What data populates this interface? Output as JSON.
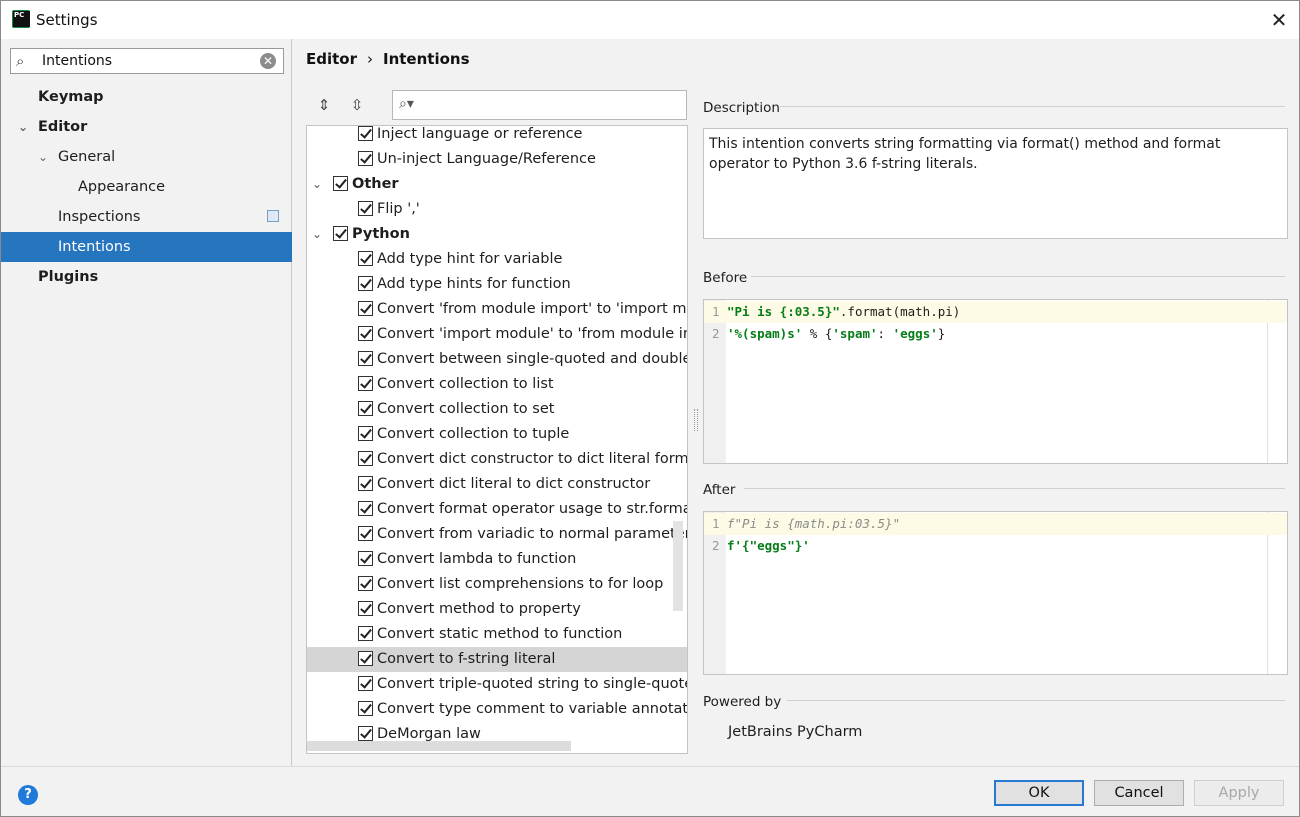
{
  "window": {
    "title": "Settings",
    "close_glyph": "✕"
  },
  "sidebar": {
    "search_value": "Intentions",
    "items": [
      {
        "label": "Keymap"
      },
      {
        "label": "Editor"
      },
      {
        "label": "General"
      },
      {
        "label": "Appearance"
      },
      {
        "label": "Inspections"
      },
      {
        "label": "Intentions"
      },
      {
        "label": "Plugins"
      }
    ]
  },
  "breadcrumb": {
    "parent": "Editor",
    "separator": "›",
    "current": "Intentions"
  },
  "tree": {
    "search_value": "",
    "rows": [
      {
        "label": "Inject language or reference",
        "checked": true
      },
      {
        "label": "Un-inject Language/Reference",
        "checked": true
      },
      {
        "label": "Other",
        "checked": true,
        "group": true
      },
      {
        "label": "Flip ','",
        "checked": true
      },
      {
        "label": "Python",
        "checked": true,
        "group": true
      },
      {
        "label": "Add type hint for variable",
        "checked": true
      },
      {
        "label": "Add type hints for function",
        "checked": true
      },
      {
        "label": "Convert 'from module import' to 'import module'",
        "checked": true
      },
      {
        "label": "Convert 'import module' to 'from module import'",
        "checked": true
      },
      {
        "label": "Convert between single-quoted and double-quoted strings",
        "checked": true
      },
      {
        "label": "Convert collection to list",
        "checked": true
      },
      {
        "label": "Convert collection to set",
        "checked": true
      },
      {
        "label": "Convert collection to tuple",
        "checked": true
      },
      {
        "label": "Convert dict constructor to dict literal form",
        "checked": true
      },
      {
        "label": "Convert dict literal to dict constructor",
        "checked": true
      },
      {
        "label": "Convert format operator usage to str.format method",
        "checked": true
      },
      {
        "label": "Convert from variadic to normal parameter(s)",
        "checked": true
      },
      {
        "label": "Convert lambda to function",
        "checked": true
      },
      {
        "label": "Convert list comprehensions to for loop",
        "checked": true
      },
      {
        "label": "Convert method to property",
        "checked": true
      },
      {
        "label": "Convert static method to function",
        "checked": true
      },
      {
        "label": "Convert to f-string literal",
        "checked": true,
        "selected": true
      },
      {
        "label": "Convert triple-quoted string to single-quoted string",
        "checked": true
      },
      {
        "label": "Convert type comment to variable annotation",
        "checked": true
      },
      {
        "label": "DeMorgan law",
        "checked": true
      }
    ]
  },
  "description": {
    "title": "Description",
    "text": "This intention converts string formatting via format() method and format operator to Python 3.6 f-string literals."
  },
  "before": {
    "title": "Before",
    "lines": [
      {
        "num": "1",
        "parts": [
          [
            "str",
            "\"Pi is {:03.5}\""
          ],
          [
            "fn",
            ".format(math.pi)"
          ]
        ]
      },
      {
        "num": "2",
        "parts": [
          [
            "str",
            "'%(spam)s'"
          ],
          [
            "fn",
            " % {"
          ],
          [
            "str",
            "'spam'"
          ],
          [
            "fn",
            ": "
          ],
          [
            "str",
            "'eggs'"
          ],
          [
            "fn",
            "}"
          ]
        ]
      }
    ]
  },
  "after": {
    "title": "After",
    "lines": [
      {
        "num": "1",
        "parts": [
          [
            "dim",
            "f\"Pi is {math.pi:03.5}\""
          ]
        ]
      },
      {
        "num": "2",
        "parts": [
          [
            "str",
            "f'{\"eggs\"}'"
          ]
        ]
      }
    ]
  },
  "powered_by": {
    "title": "Powered by",
    "value": "JetBrains PyCharm"
  },
  "footer": {
    "help": "?",
    "ok": "OK",
    "cancel": "Cancel",
    "apply": "Apply"
  }
}
